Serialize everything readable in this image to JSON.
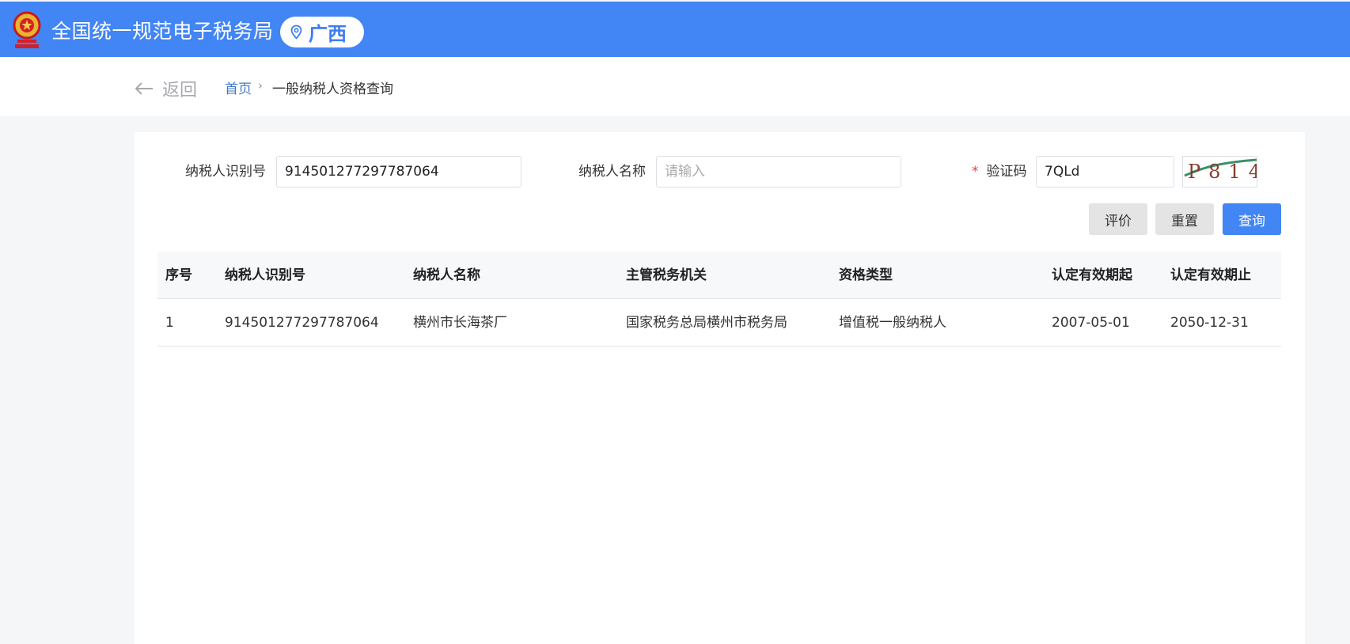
{
  "header": {
    "title": "全国统一规范电子税务局",
    "region": "广西"
  },
  "nav": {
    "back_label": "返回",
    "breadcrumb": [
      "首页",
      "一般纳税人资格查询"
    ],
    "separator": "›"
  },
  "form": {
    "taxpayer_id": {
      "label": "纳税人识别号",
      "value": "914501277297787064"
    },
    "taxpayer_name": {
      "label": "纳税人名称",
      "value": "",
      "placeholder": "请输入"
    },
    "captcha": {
      "required_mark": "*",
      "label": "验证码",
      "value": "7QLd",
      "image_text": "P814"
    }
  },
  "buttons": {
    "evaluate": "评价",
    "reset": "重置",
    "query": "查询"
  },
  "table": {
    "headers": [
      "序号",
      "纳税人识别号",
      "纳税人名称",
      "主管税务机关",
      "资格类型",
      "认定有效期起",
      "认定有效期止"
    ],
    "rows": [
      [
        "1",
        "914501277297787064",
        "横州市长海茶厂",
        "国家税务总局横州市税务局",
        "增值税一般纳税人",
        "2007-05-01",
        "2050-12-31"
      ]
    ]
  },
  "colors": {
    "brand_blue": "#4285f4",
    "link_blue": "#3f78c8",
    "required_red": "#e8453c"
  }
}
